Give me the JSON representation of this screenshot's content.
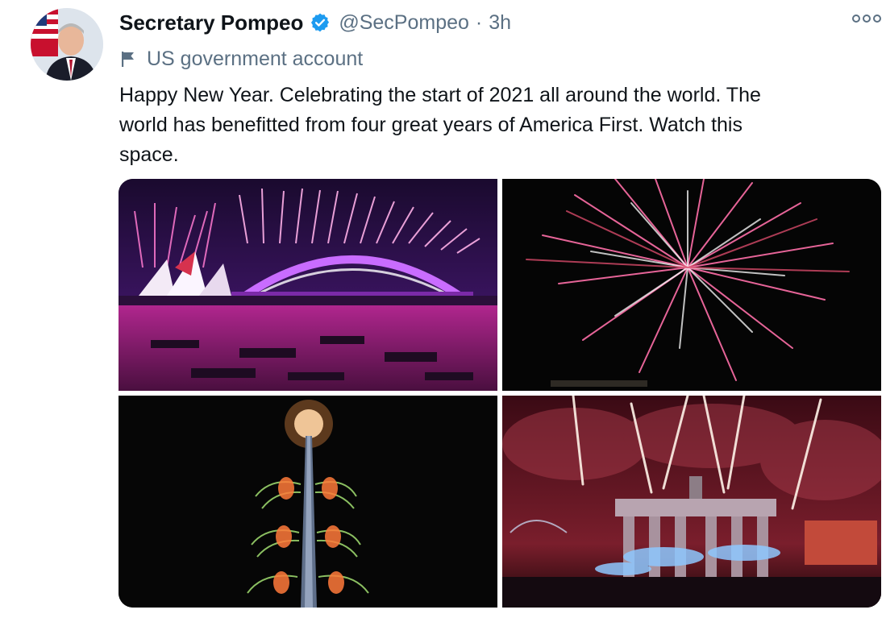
{
  "tweet": {
    "author_name": "Secretary Pompeo",
    "handle": "@SecPompeo",
    "separator": "·",
    "time": "3h",
    "label": "US government account",
    "text": "Happy New Year. Celebrating the start of 2021 all around the world. The\nworld has benefitted from four great years of America First. Watch this\nspace."
  },
  "icons": {
    "avatar": "portrait-avatar",
    "verified": "verified-badge-icon",
    "more": "more-options-icon",
    "flag": "flag-icon"
  },
  "colors": {
    "verified": "#1d9bf0",
    "secondary_text": "#5b7083",
    "primary_text": "#0f1419"
  },
  "media": {
    "images": [
      {
        "subject": "Sydney Harbour fireworks"
      },
      {
        "subject": "Fireworks burst"
      },
      {
        "subject": "Burj Khalifa fireworks"
      },
      {
        "subject": "Brandenburg Gate fireworks"
      }
    ]
  }
}
